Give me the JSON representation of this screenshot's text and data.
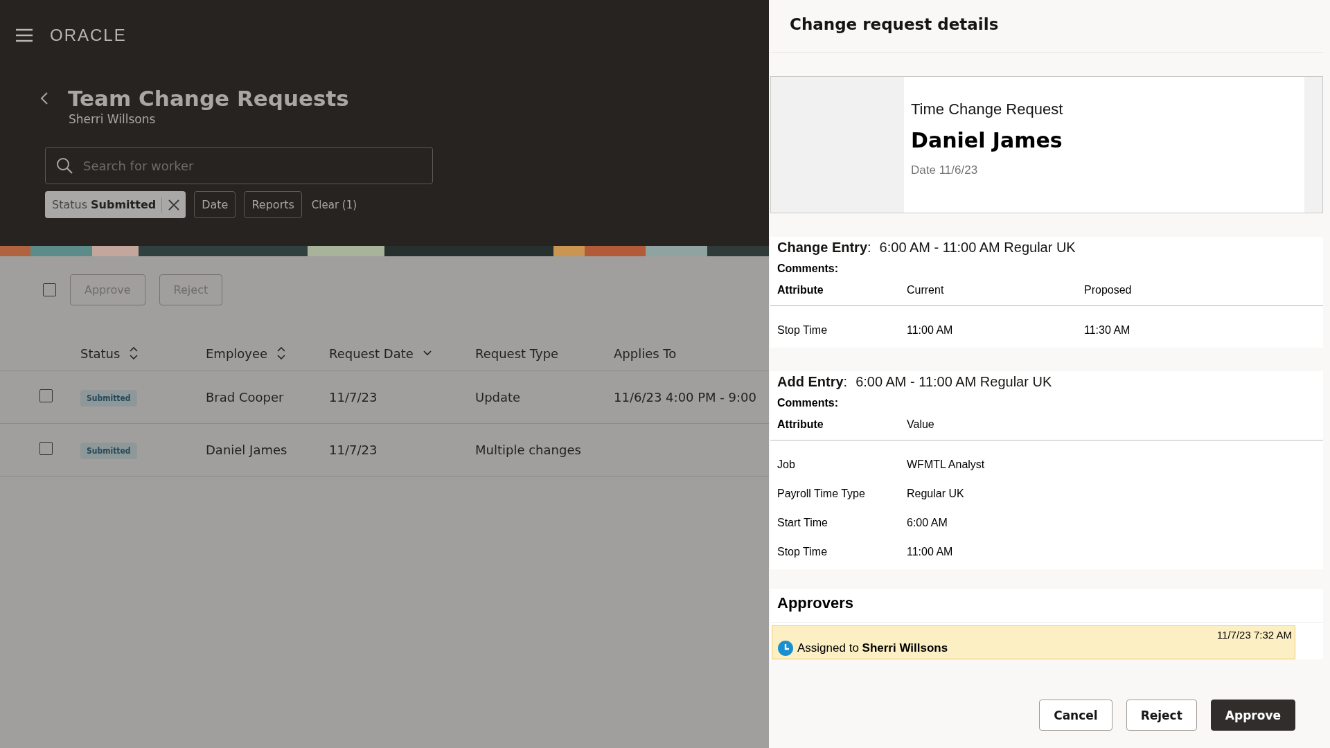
{
  "header": {
    "logo": "ORACLE"
  },
  "page": {
    "title": "Team Change Requests",
    "subtitle": "Sherri Willsons"
  },
  "search": {
    "placeholder": "Search for worker"
  },
  "filters": [
    {
      "kind": "chip",
      "label": "Status",
      "value": "Submitted"
    },
    {
      "kind": "button",
      "label": "Date"
    },
    {
      "kind": "button",
      "label": "Reports"
    },
    {
      "kind": "link",
      "label": "Clear (1)"
    }
  ],
  "toolbar": {
    "select_all_checked": false,
    "buttons": [
      {
        "label": "Approve",
        "disabled": true
      },
      {
        "label": "Reject",
        "disabled": true
      }
    ]
  },
  "table": {
    "columns": [
      {
        "label": "Status",
        "kind": "sortable"
      },
      {
        "label": "Employee",
        "kind": "sortable"
      },
      {
        "label": "Request Date",
        "kind": "sorted_desc"
      },
      {
        "label": "Request Type",
        "kind": "plain"
      },
      {
        "label": "Applies To",
        "kind": "plain"
      }
    ],
    "rows": [
      {
        "checked": false,
        "status": "Submitted",
        "employee": "Brad Cooper",
        "request_date": "11/7/23",
        "request_type": "Update",
        "applies_to": "11/6/23 4:00 PM - 9:00"
      },
      {
        "checked": false,
        "status": "Submitted",
        "employee": "Daniel James",
        "request_date": "11/7/23",
        "request_type": "Multiple changes",
        "applies_to": ""
      }
    ]
  },
  "drawer": {
    "title": "Change request details",
    "card": {
      "type": "Time Change Request",
      "name": "Daniel James",
      "date": "Date 11/6/23"
    },
    "sections": [
      {
        "heading": "**Change Entry**:",
        "summary": "6:00 AM - 11:00 AM Regular UK",
        "comments_label": "Comments:",
        "columns": [
          "Attribute",
          "Current",
          "Proposed"
        ],
        "rows": [
          [
            "Stop Time",
            "11:00 AM",
            "11:30 AM"
          ]
        ]
      },
      {
        "heading": "**Add Entry**:",
        "summary": "6:00 AM - 11:00 AM Regular UK",
        "comments_label": "Comments:",
        "columns": [
          "Attribute",
          "Value"
        ],
        "rows": [
          [
            "Job",
            "WFMTL Analyst"
          ],
          [
            "Payroll Time Type",
            "Regular UK"
          ],
          [
            "Start Time",
            "6:00 AM"
          ],
          [
            "Stop Time",
            "11:00 AM"
          ]
        ]
      }
    ],
    "approvers": {
      "title": "Approvers",
      "items": [
        {
          "time": "11/7/23 7:32 AM",
          "text": "Assigned to **Sherri Willsons**"
        }
      ]
    },
    "buttons": [
      {
        "label": "Cancel",
        "kind": "secondary"
      },
      {
        "label": "Reject",
        "kind": "secondary"
      },
      {
        "label": "Approve",
        "kind": "primary"
      }
    ]
  }
}
